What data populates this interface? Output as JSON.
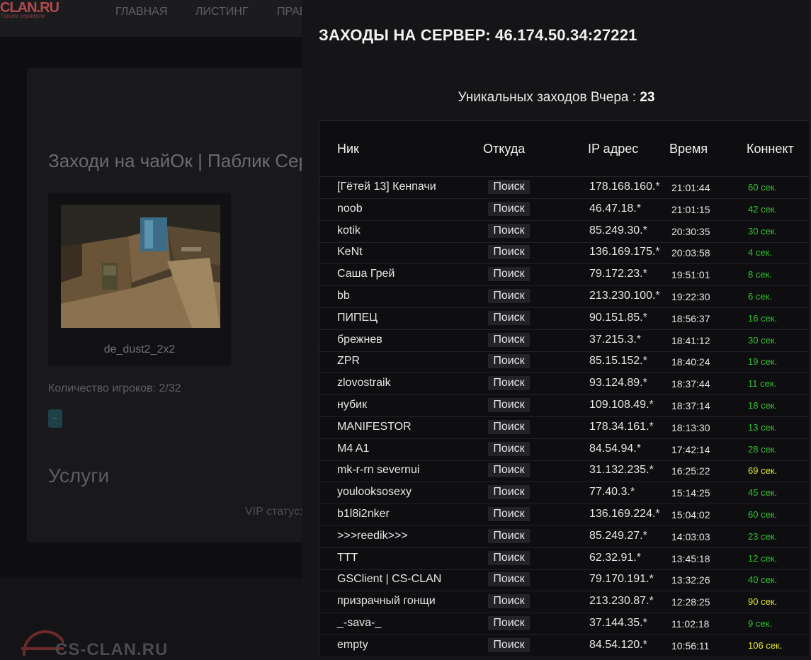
{
  "colors": {
    "conn_green": "#35c235",
    "conn_yellow": "#e6e63a",
    "accent_red": "#b24a4a"
  },
  "bg": {
    "logo": "CLAN.RU",
    "logo_sub": "Ториег серверов",
    "nav": [
      "ГЛАВНАЯ",
      "ЛИСТИНГ",
      "ПРАВ"
    ],
    "server_title": "Заходи на чайОк | Паблик Сер",
    "map_name": "de_dust2_2x2",
    "players_label": "Количество игроков:",
    "players_value": "2/32",
    "services_title": "Услуги",
    "vip_label": "VIP статус:",
    "footer_logo": "CS-CLAN.RU"
  },
  "modal": {
    "title": "ЗАХОДЫ НА СЕРВЕР: 46.174.50.34:27221",
    "unique_label": "Уникальных заходов Вчера :",
    "unique_count": "23",
    "headers": [
      "Ник",
      "Откуда",
      "IP адрес",
      "Время",
      "Коннект"
    ],
    "rows": [
      {
        "nick": "[Гётей 13] Кенпачи",
        "from": "Поиск",
        "ip": "178.168.160.*",
        "time": "21:01:44",
        "conn": "60 сек.",
        "level": "green"
      },
      {
        "nick": "noob",
        "from": "Поиск",
        "ip": "46.47.18.*",
        "time": "21:01:15",
        "conn": "42 сек.",
        "level": "green"
      },
      {
        "nick": "kotik",
        "from": "Поиск",
        "ip": "85.249.30.*",
        "time": "20:30:35",
        "conn": "30 сек.",
        "level": "green"
      },
      {
        "nick": "KeNt",
        "from": "Поиск",
        "ip": "136.169.175.*",
        "time": "20:03:58",
        "conn": "4 сек.",
        "level": "green"
      },
      {
        "nick": "Саша Грей",
        "from": "Поиск",
        "ip": "79.172.23.*",
        "time": "19:51:01",
        "conn": "8 сек.",
        "level": "green"
      },
      {
        "nick": "bb",
        "from": "Поиск",
        "ip": "213.230.100.*",
        "time": "19:22:30",
        "conn": "6 сек.",
        "level": "green"
      },
      {
        "nick": "ПИПЕЦ",
        "from": "Поиск",
        "ip": "90.151.85.*",
        "time": "18:56:37",
        "conn": "16 сек.",
        "level": "green"
      },
      {
        "nick": "брежнев",
        "from": "Поиск",
        "ip": "37.215.3.*",
        "time": "18:41:12",
        "conn": "30 сек.",
        "level": "green"
      },
      {
        "nick": "ZPR",
        "from": "Поиск",
        "ip": "85.15.152.*",
        "time": "18:40:24",
        "conn": "19 сек.",
        "level": "green"
      },
      {
        "nick": "zlovostraik",
        "from": "Поиск",
        "ip": "93.124.89.*",
        "time": "18:37:44",
        "conn": "11 сек.",
        "level": "green"
      },
      {
        "nick": "нубик",
        "from": "Поиск",
        "ip": "109.108.49.*",
        "time": "18:37:14",
        "conn": "18 сек.",
        "level": "green"
      },
      {
        "nick": "MANIFESTOR",
        "from": "Поиск",
        "ip": "178.34.161.*",
        "time": "18:13:30",
        "conn": "13 сек.",
        "level": "green"
      },
      {
        "nick": "M4 A1",
        "from": "Поиск",
        "ip": "84.54.94.*",
        "time": "17:42:14",
        "conn": "28 сек.",
        "level": "green"
      },
      {
        "nick": "mk-r-rn severnui",
        "from": "Поиск",
        "ip": "31.132.235.*",
        "time": "16:25:22",
        "conn": "69 сек.",
        "level": "yellow"
      },
      {
        "nick": "youlooksosexy",
        "from": "Поиск",
        "ip": "77.40.3.*",
        "time": "15:14:25",
        "conn": "45 сек.",
        "level": "green"
      },
      {
        "nick": "b1l8i2nker",
        "from": "Поиск",
        "ip": "136.169.224.*",
        "time": "15:04:02",
        "conn": "60 сек.",
        "level": "green"
      },
      {
        "nick": ">>>reedik>>>",
        "from": "Поиск",
        "ip": "85.249.27.*",
        "time": "14:03:03",
        "conn": "23 сек.",
        "level": "green"
      },
      {
        "nick": "TTT",
        "from": "Поиск",
        "ip": "62.32.91.*",
        "time": "13:45:18",
        "conn": "12 сек.",
        "level": "green"
      },
      {
        "nick": "GSClient | CS-CLAN",
        "from": "Поиск",
        "ip": "79.170.191.*",
        "time": "13:32:26",
        "conn": "40 сек.",
        "level": "green"
      },
      {
        "nick": "призрачный гонщи",
        "from": "Поиск",
        "ip": "213.230.87.*",
        "time": "12:28:25",
        "conn": "90 сек.",
        "level": "yellow"
      },
      {
        "nick": "_-sava-_",
        "from": "Поиск",
        "ip": "37.144.35.*",
        "time": "11:02:18",
        "conn": "9 сек.",
        "level": "green"
      },
      {
        "nick": "empty",
        "from": "Поиск",
        "ip": "84.54.120.*",
        "time": "10:56:11",
        "conn": "106 сек.",
        "level": "yellow"
      }
    ]
  }
}
